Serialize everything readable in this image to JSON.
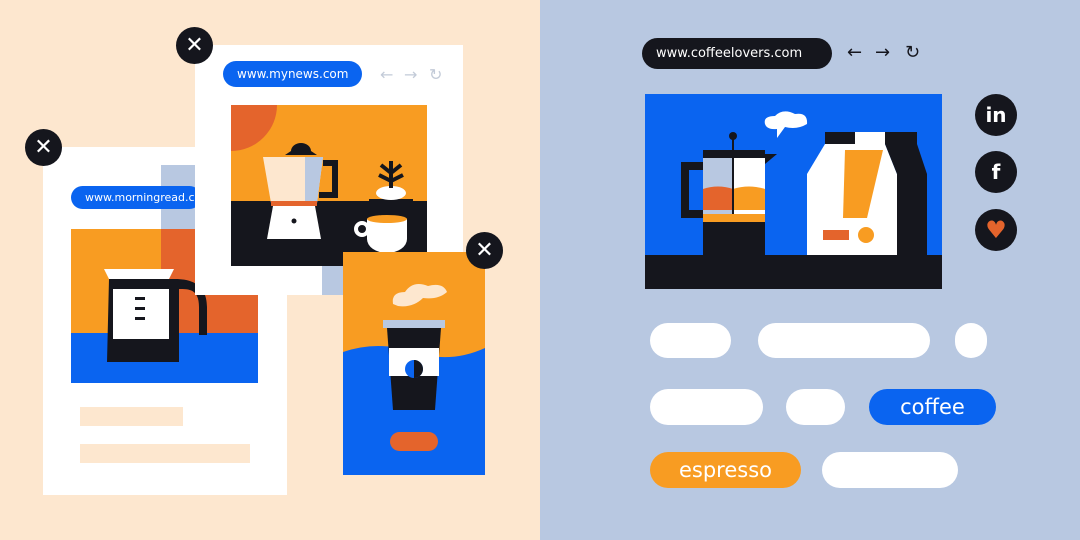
{
  "colors": {
    "blue": "#0a64f0",
    "orange": "#f89c22",
    "dark": "#15161d",
    "rust": "#e4642c",
    "peach": "#fde7cf",
    "slate": "#b8c8e1"
  },
  "left": {
    "morningread": {
      "url": "www.morningread.com"
    },
    "mynews": {
      "url": "www.mynews.com",
      "nav": [
        "←",
        "→",
        "↻"
      ]
    },
    "close_icon": "✕"
  },
  "right": {
    "url": "www.coffeelovers.com",
    "nav": [
      "←",
      "→",
      "↻"
    ],
    "social": [
      {
        "icon": "linkedin-icon",
        "label": "in"
      },
      {
        "icon": "facebook-icon",
        "label": "f"
      },
      {
        "icon": "heart-icon",
        "label": "♥"
      }
    ],
    "tags": {
      "coffee": "coffee",
      "espresso": "espresso"
    }
  }
}
